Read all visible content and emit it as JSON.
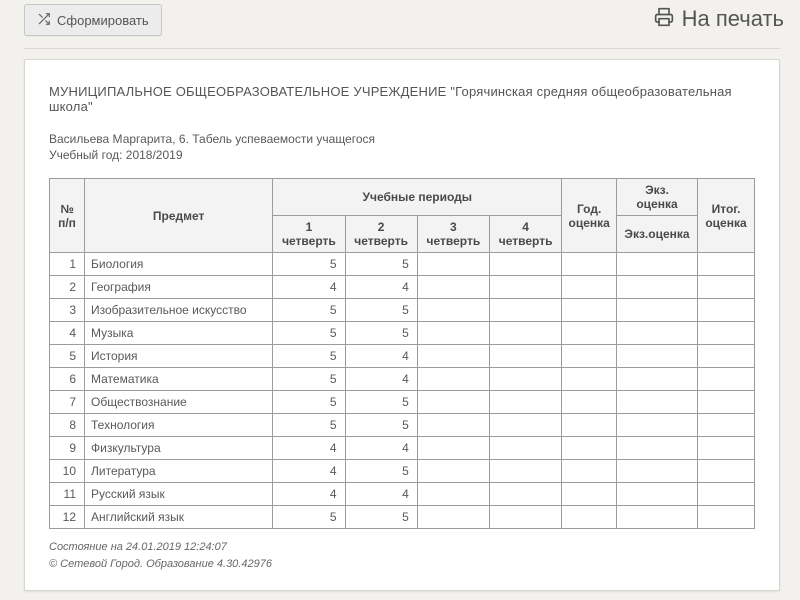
{
  "toolbar": {
    "generate_label": "Сформировать",
    "print_label": "На печать"
  },
  "header": {
    "prefix": "МУНИЦИПАЛЬНОЕ ОБЩЕОБРАЗОВАТЕЛЬНОЕ УЧРЕЖДЕНИЕ",
    "school": "\"Горячинская средняя общеобразовательная школа\""
  },
  "student_line": "Васильева Маргарита, 6. Табель успеваемости учащегося",
  "year_line": "Учебный год: 2018/2019",
  "columns": {
    "idx": "№ п/п",
    "subject": "Предмет",
    "periods_group": "Учебные периоды",
    "q1": "1 четверть",
    "q2": "2 четверть",
    "q3": "3 четверть",
    "q4": "4 четверть",
    "year": "Год. оценка",
    "exam_group": "Экз. оценка",
    "exam": "Экз.оценка",
    "final": "Итог. оценка"
  },
  "rows": [
    {
      "n": 1,
      "subject": "Биология",
      "q1": 5,
      "q2": 5
    },
    {
      "n": 2,
      "subject": "География",
      "q1": 4,
      "q2": 4
    },
    {
      "n": 3,
      "subject": "Изобразительное искусство",
      "q1": 5,
      "q2": 5
    },
    {
      "n": 4,
      "subject": "Музыка",
      "q1": 5,
      "q2": 5
    },
    {
      "n": 5,
      "subject": "История",
      "q1": 5,
      "q2": 4
    },
    {
      "n": 6,
      "subject": "Математика",
      "q1": 5,
      "q2": 4
    },
    {
      "n": 7,
      "subject": "Обществознание",
      "q1": 5,
      "q2": 5
    },
    {
      "n": 8,
      "subject": "Технология",
      "q1": 5,
      "q2": 5
    },
    {
      "n": 9,
      "subject": "Физкультура",
      "q1": 4,
      "q2": 4
    },
    {
      "n": 10,
      "subject": "Литература",
      "q1": 4,
      "q2": 5
    },
    {
      "n": 11,
      "subject": "Русский язык",
      "q1": 4,
      "q2": 4
    },
    {
      "n": 12,
      "subject": "Английский язык",
      "q1": 5,
      "q2": 5
    }
  ],
  "footer": {
    "state": "Состояние на 24.01.2019 12:24:07",
    "copyright": "© Сетевой Город. Образование 4.30.42976"
  },
  "chart_data": {
    "type": "table",
    "title": "Табель успеваемости учащегося — Васильева Маргарита, 6 (2018/2019)",
    "columns": [
      "№ п/п",
      "Предмет",
      "1 четверть",
      "2 четверть",
      "3 четверть",
      "4 четверть",
      "Год. оценка",
      "Экз.оценка",
      "Итог. оценка"
    ],
    "rows": [
      [
        1,
        "Биология",
        5,
        5,
        null,
        null,
        null,
        null,
        null
      ],
      [
        2,
        "География",
        4,
        4,
        null,
        null,
        null,
        null,
        null
      ],
      [
        3,
        "Изобразительное искусство",
        5,
        5,
        null,
        null,
        null,
        null,
        null
      ],
      [
        4,
        "Музыка",
        5,
        5,
        null,
        null,
        null,
        null,
        null
      ],
      [
        5,
        "История",
        5,
        4,
        null,
        null,
        null,
        null,
        null
      ],
      [
        6,
        "Математика",
        5,
        4,
        null,
        null,
        null,
        null,
        null
      ],
      [
        7,
        "Обществознание",
        5,
        5,
        null,
        null,
        null,
        null,
        null
      ],
      [
        8,
        "Технология",
        5,
        5,
        null,
        null,
        null,
        null,
        null
      ],
      [
        9,
        "Физкультура",
        4,
        4,
        null,
        null,
        null,
        null,
        null
      ],
      [
        10,
        "Литература",
        4,
        5,
        null,
        null,
        null,
        null,
        null
      ],
      [
        11,
        "Русский язык",
        4,
        4,
        null,
        null,
        null,
        null,
        null
      ],
      [
        12,
        "Английский язык",
        5,
        5,
        null,
        null,
        null,
        null,
        null
      ]
    ]
  }
}
